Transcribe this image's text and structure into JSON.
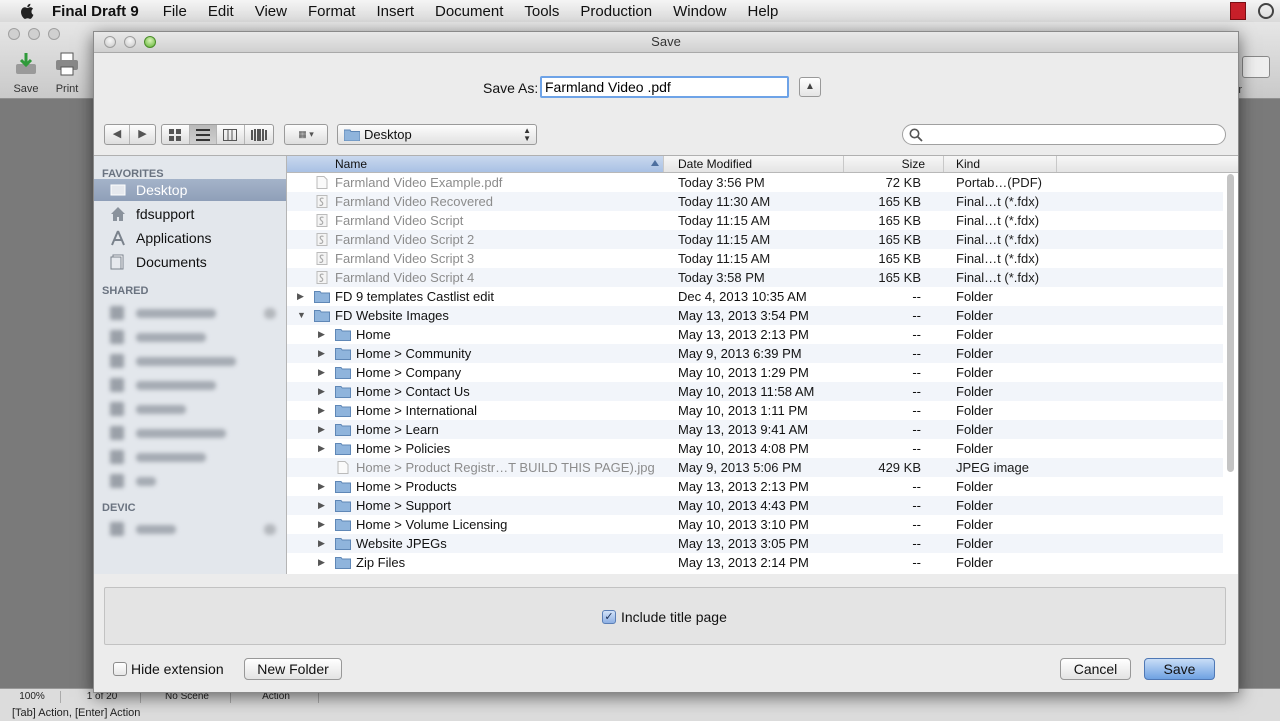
{
  "menubar": {
    "app_name": "Final Draft 9",
    "items": [
      "File",
      "Edit",
      "View",
      "Format",
      "Insert",
      "Document",
      "Tools",
      "Production",
      "Window",
      "Help"
    ]
  },
  "app": {
    "toolbar": {
      "save_label": "Save",
      "print_label": "Print",
      "right_partial_label": "tor"
    },
    "status": {
      "zoom": "100%",
      "page": "1 of 20",
      "scene": "No Scene",
      "element": "Action",
      "hint": "[Tab]  Action,  [Enter] Action"
    }
  },
  "dialog": {
    "title": "Save",
    "save_as_label": "Save As:",
    "filename": "Farmland Video .pdf",
    "location": "Desktop",
    "search_placeholder": "",
    "sidebar": {
      "favorites_header": "FAVORITES",
      "favorites": [
        "Desktop",
        "fdsupport",
        "Applications",
        "Documents"
      ],
      "shared_header": "SHARED",
      "devices_header": "DEVICES"
    },
    "columns": {
      "name": "Name",
      "date": "Date Modified",
      "size": "Size",
      "kind": "Kind"
    },
    "files": [
      {
        "name": "Farmland Video Example.pdf",
        "date": "Today 3:56 PM",
        "size": "72 KB",
        "kind": "Portab…(PDF)",
        "type": "file",
        "level": 0,
        "dim": true
      },
      {
        "name": "Farmland Video Recovered",
        "date": "Today 11:30 AM",
        "size": "165 KB",
        "kind": "Final…t (*.fdx)",
        "type": "fdx",
        "level": 0,
        "dim": true
      },
      {
        "name": "Farmland Video Script",
        "date": "Today 11:15 AM",
        "size": "165 KB",
        "kind": "Final…t (*.fdx)",
        "type": "fdx",
        "level": 0,
        "dim": true
      },
      {
        "name": "Farmland Video Script 2",
        "date": "Today 11:15 AM",
        "size": "165 KB",
        "kind": "Final…t (*.fdx)",
        "type": "fdx",
        "level": 0,
        "dim": true
      },
      {
        "name": "Farmland Video Script 3",
        "date": "Today 11:15 AM",
        "size": "165 KB",
        "kind": "Final…t (*.fdx)",
        "type": "fdx",
        "level": 0,
        "dim": true
      },
      {
        "name": "Farmland Video Script 4",
        "date": "Today 3:58 PM",
        "size": "165 KB",
        "kind": "Final…t (*.fdx)",
        "type": "fdx",
        "level": 0,
        "dim": true
      },
      {
        "name": "FD 9 templates Castlist edit",
        "date": "Dec 4, 2013 10:35 AM",
        "size": "--",
        "kind": "Folder",
        "type": "folder",
        "level": 0,
        "expanded": false
      },
      {
        "name": "FD Website Images",
        "date": "May 13, 2013 3:54 PM",
        "size": "--",
        "kind": "Folder",
        "type": "folder",
        "level": 0,
        "expanded": true
      },
      {
        "name": "Home",
        "date": "May 13, 2013 2:13 PM",
        "size": "--",
        "kind": "Folder",
        "type": "folder",
        "level": 1,
        "expanded": false
      },
      {
        "name": "Home > Community",
        "date": "May 9, 2013 6:39 PM",
        "size": "--",
        "kind": "Folder",
        "type": "folder",
        "level": 1,
        "expanded": false
      },
      {
        "name": "Home > Company",
        "date": "May 10, 2013 1:29 PM",
        "size": "--",
        "kind": "Folder",
        "type": "folder",
        "level": 1,
        "expanded": false
      },
      {
        "name": "Home > Contact Us",
        "date": "May 10, 2013 11:58 AM",
        "size": "--",
        "kind": "Folder",
        "type": "folder",
        "level": 1,
        "expanded": false
      },
      {
        "name": "Home > International",
        "date": "May 10, 2013 1:11 PM",
        "size": "--",
        "kind": "Folder",
        "type": "folder",
        "level": 1,
        "expanded": false
      },
      {
        "name": "Home > Learn",
        "date": "May 13, 2013 9:41 AM",
        "size": "--",
        "kind": "Folder",
        "type": "folder",
        "level": 1,
        "expanded": false
      },
      {
        "name": "Home > Policies",
        "date": "May 10, 2013 4:08 PM",
        "size": "--",
        "kind": "Folder",
        "type": "folder",
        "level": 1,
        "expanded": false
      },
      {
        "name": "Home > Product Registr…T BUILD THIS PAGE).jpg",
        "date": "May 9, 2013 5:06 PM",
        "size": "429 KB",
        "kind": "JPEG image",
        "type": "file",
        "level": 1,
        "dim": true
      },
      {
        "name": "Home > Products",
        "date": "May 13, 2013 2:13 PM",
        "size": "--",
        "kind": "Folder",
        "type": "folder",
        "level": 1,
        "expanded": false
      },
      {
        "name": "Home > Support",
        "date": "May 10, 2013 4:43 PM",
        "size": "--",
        "kind": "Folder",
        "type": "folder",
        "level": 1,
        "expanded": false
      },
      {
        "name": "Home > Volume Licensing",
        "date": "May 10, 2013 3:10 PM",
        "size": "--",
        "kind": "Folder",
        "type": "folder",
        "level": 1,
        "expanded": false
      },
      {
        "name": "Website JPEGs",
        "date": "May 13, 2013 3:05 PM",
        "size": "--",
        "kind": "Folder",
        "type": "folder",
        "level": 1,
        "expanded": false
      },
      {
        "name": "Zip Files",
        "date": "May 13, 2013 2:14 PM",
        "size": "--",
        "kind": "Folder",
        "type": "folder",
        "level": 1,
        "expanded": false
      }
    ],
    "include_title_page": {
      "label": "Include title page",
      "checked": true
    },
    "hide_extension": {
      "label": "Hide extension",
      "checked": false
    },
    "buttons": {
      "new_folder": "New Folder",
      "cancel": "Cancel",
      "save": "Save"
    }
  },
  "colors": {
    "selection": "#8f9fb8",
    "folder": "#8fb4dc",
    "default_button": "#6fa1e2"
  }
}
